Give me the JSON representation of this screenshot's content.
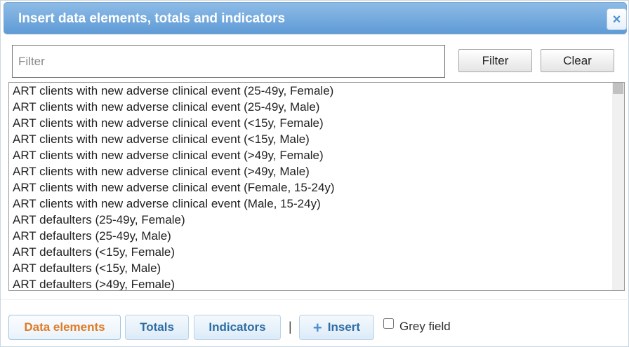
{
  "dialog": {
    "title": "Insert data elements, totals and indicators",
    "close_symbol": "×"
  },
  "filter": {
    "placeholder": "Filter",
    "value": "",
    "filter_label": "Filter",
    "clear_label": "Clear"
  },
  "list": {
    "items": [
      "ART clients with new adverse clinical event (25-49y, Female)",
      "ART clients with new adverse clinical event (25-49y, Male)",
      "ART clients with new adverse clinical event (<15y, Female)",
      "ART clients with new adverse clinical event (<15y, Male)",
      "ART clients with new adverse clinical event (>49y, Female)",
      "ART clients with new adverse clinical event (>49y, Male)",
      "ART clients with new adverse clinical event (Female, 15-24y)",
      "ART clients with new adverse clinical event (Male, 15-24y)",
      "ART defaulters (25-49y, Female)",
      "ART defaulters (25-49y, Male)",
      "ART defaulters (<15y, Female)",
      "ART defaulters (<15y, Male)",
      "ART defaulters (>49y, Female)"
    ]
  },
  "footer": {
    "tabs": [
      {
        "label": "Data elements",
        "active": true
      },
      {
        "label": "Totals",
        "active": false
      },
      {
        "label": "Indicators",
        "active": false
      }
    ],
    "separator": "|",
    "insert_label": "Insert",
    "insert_icon": "plus-icon",
    "grey_field_label": "Grey field",
    "grey_field_checked": false
  },
  "colors": {
    "title_bar": "#6ea7dd",
    "active_tab_text": "#e07b26",
    "tab_text": "#2e6da4"
  }
}
